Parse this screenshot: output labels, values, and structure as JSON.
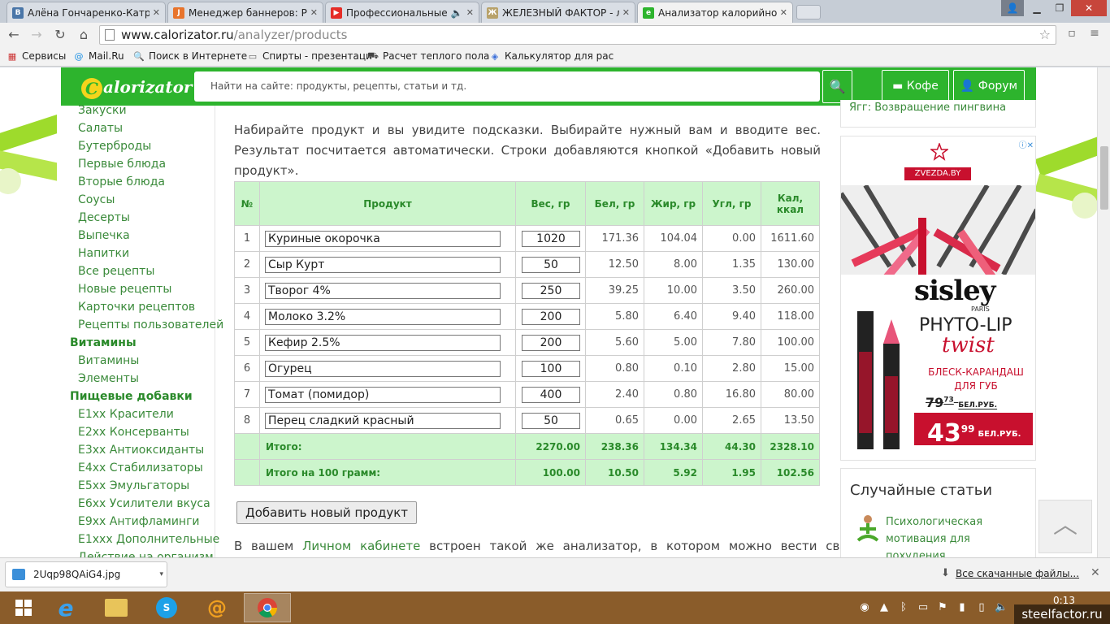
{
  "browser": {
    "tabs": [
      {
        "label": "Алёна Гончаренко-Катр",
        "fav": "vk-icon"
      },
      {
        "label": "Менеджер баннеров: Ре",
        "fav": "joomla-icon"
      },
      {
        "label": "Профессиональные Г",
        "fav": "youtube-icon"
      },
      {
        "label": "ЖЕЛЕЗНЫЙ ФАКТОР - лу",
        "fav": "site-icon"
      },
      {
        "label": "Анализатор калорийност",
        "fav": "calorizator-icon"
      }
    ],
    "url_host": "www.calorizator.ru",
    "url_path": "/analyzer/products",
    "bookmarks": [
      {
        "label": "Сервисы",
        "icon": "apps-icon"
      },
      {
        "label": "Mail.Ru",
        "icon": "mailru-icon"
      },
      {
        "label": "Поиск в Интернете",
        "icon": "search-icon"
      },
      {
        "label": "Спирты - презентаци",
        "icon": "document-icon"
      },
      {
        "label": "Расчет теплого пола",
        "icon": "car-icon"
      },
      {
        "label": "Калькулятор для рас",
        "icon": "droplet-icon"
      }
    ]
  },
  "site": {
    "logo": "alorizator",
    "logo_letter": "C",
    "search_placeholder": "Найти на сайте: продукты, рецепты, статьи и тд.",
    "coffee_label": "Кофе",
    "forum_label": "Форум",
    "top_right_link": "Ягг: Возвращение пингвина"
  },
  "leftnav": [
    {
      "label": "Закуски",
      "head": false
    },
    {
      "label": "Салаты",
      "head": false
    },
    {
      "label": "Бутерброды",
      "head": false
    },
    {
      "label": "Первые блюда",
      "head": false
    },
    {
      "label": "Вторые блюда",
      "head": false
    },
    {
      "label": "Соусы",
      "head": false
    },
    {
      "label": "Десерты",
      "head": false
    },
    {
      "label": "Выпечка",
      "head": false
    },
    {
      "label": "Напитки",
      "head": false
    },
    {
      "label": "Все рецепты",
      "head": false
    },
    {
      "label": "Новые рецепты",
      "head": false
    },
    {
      "label": "Карточки рецептов",
      "head": false
    },
    {
      "label": "Рецепты пользователей",
      "head": false
    },
    {
      "label": "Витамины",
      "head": true
    },
    {
      "label": "Витамины",
      "head": false
    },
    {
      "label": "Элементы",
      "head": false
    },
    {
      "label": "Пищевые добавки",
      "head": true
    },
    {
      "label": "E1xx Красители",
      "head": false
    },
    {
      "label": "E2xx Консерванты",
      "head": false
    },
    {
      "label": "E3xx Антиоксиданты",
      "head": false
    },
    {
      "label": "E4xx Стабилизаторы",
      "head": false
    },
    {
      "label": "E5xx Эмульгаторы",
      "head": false
    },
    {
      "label": "E6xx Усилители вкуса",
      "head": false
    },
    {
      "label": "E9xx Антифламинги",
      "head": false
    },
    {
      "label": "E1xxx Дополнительные",
      "head": false
    },
    {
      "label": "Действие на организм",
      "head": false
    }
  ],
  "intro": "Набирайте продукт и вы увидите подсказки. Выбирайте нужный вам и вводите вес. Результат посчитается автоматически. Строки добавляются кнопкой «Добавить новый продукт».",
  "table": {
    "headers": [
      "№",
      "Продукт",
      "Вес, гр",
      "Бел, гр",
      "Жир, гр",
      "Угл, гр",
      "Кал, ккал"
    ],
    "rows": [
      {
        "n": "1",
        "product": "Куриные окорочка",
        "weight": "1020",
        "prot": "171.36",
        "fat": "104.04",
        "carb": "0.00",
        "kcal": "1611.60"
      },
      {
        "n": "2",
        "product": "Сыр Курт",
        "weight": "50",
        "prot": "12.50",
        "fat": "8.00",
        "carb": "1.35",
        "kcal": "130.00"
      },
      {
        "n": "3",
        "product": "Творог 4%",
        "weight": "250",
        "prot": "39.25",
        "fat": "10.00",
        "carb": "3.50",
        "kcal": "260.00"
      },
      {
        "n": "4",
        "product": "Молоко 3.2%",
        "weight": "200",
        "prot": "5.80",
        "fat": "6.40",
        "carb": "9.40",
        "kcal": "118.00"
      },
      {
        "n": "5",
        "product": "Кефир 2.5%",
        "weight": "200",
        "prot": "5.60",
        "fat": "5.00",
        "carb": "7.80",
        "kcal": "100.00"
      },
      {
        "n": "6",
        "product": "Огурец",
        "weight": "100",
        "prot": "0.80",
        "fat": "0.10",
        "carb": "2.80",
        "kcal": "15.00"
      },
      {
        "n": "7",
        "product": "Томат (помидор)",
        "weight": "400",
        "prot": "2.40",
        "fat": "0.80",
        "carb": "16.80",
        "kcal": "80.00"
      },
      {
        "n": "8",
        "product": "Перец сладкий красный",
        "weight": "50",
        "prot": "0.65",
        "fat": "0.00",
        "carb": "2.65",
        "kcal": "13.50"
      }
    ],
    "totals": [
      {
        "label": "Итого:",
        "weight": "2270.00",
        "prot": "238.36",
        "fat": "134.34",
        "carb": "44.30",
        "kcal": "2328.10"
      },
      {
        "label": "Итого на 100 грамм:",
        "weight": "100.00",
        "prot": "10.50",
        "fat": "5.92",
        "carb": "1.95",
        "kcal": "102.56"
      }
    ]
  },
  "add_button": "Добавить новый продукт",
  "outro": {
    "before": "В вашем",
    "link": "Личном кабинете",
    "after": "встроен такой же анализатор, в котором можно вести свой"
  },
  "ad": {
    "brand_store": "ZVEZDA.BY",
    "brand": "sisley",
    "city": "PARIS",
    "product_line": "PHYTO-LIP",
    "product": "twist",
    "description": "БЛЕСК-КАРАНДАШ ДЛЯ ГУБ",
    "old_price": "79",
    "old_price_cents": "73",
    "new_price": "43",
    "new_price_cents": "99",
    "currency": "БЕЛ.РУБ."
  },
  "random": {
    "title": "Случайные статьи",
    "link": "Психологическая мотивация для похудения"
  },
  "download": {
    "file": "2Uqp98QAiG4.jpg",
    "all_label": "Все скачанные файлы..."
  },
  "taskbar": {
    "clock": "0:13"
  },
  "watermark": "steelfactor.ru",
  "colors": {
    "brand_green": "#2db42d",
    "table_head": "#ccf5cc",
    "link_green": "#3a8a3a",
    "ad_red": "#c8102e"
  }
}
